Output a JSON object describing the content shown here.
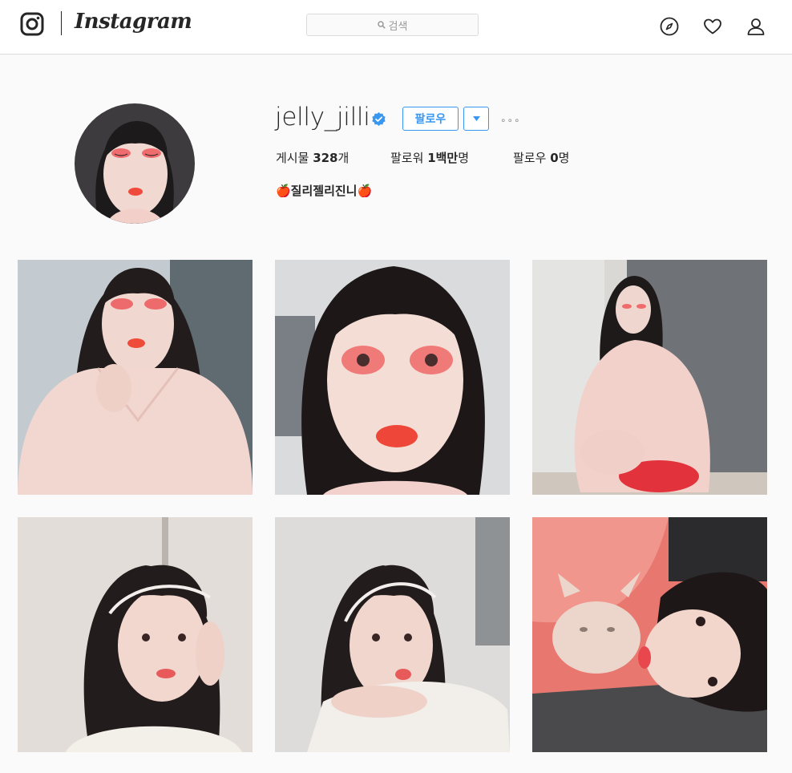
{
  "header": {
    "brand": "Instagram",
    "search_placeholder": "검색",
    "icons": [
      "instagram-glyph-icon",
      "search-icon",
      "compass-icon",
      "heart-icon",
      "user-icon"
    ]
  },
  "profile": {
    "username": "jelly_jilli",
    "follow_label": "팔로우",
    "more_label": "∘∘∘",
    "stats": {
      "posts_label": "게시물",
      "posts_value": "328",
      "posts_unit": "개",
      "followers_label": "팔로워",
      "followers_value": "1백만",
      "followers_unit": "명",
      "following_label": "팔로우",
      "following_value": "0",
      "following_unit": "명"
    },
    "bio": "🍎질리젤리진니🍎"
  },
  "colors": {
    "accent": "#3897f0",
    "verified": "#3897f0",
    "border": "#dbdbdb",
    "background": "#fafafa"
  },
  "posts": [
    {
      "subject": "selfie-red-eyeshadow"
    },
    {
      "subject": "closeup-red-eyes"
    },
    {
      "subject": "sitting-corner"
    },
    {
      "subject": "headband-selfie"
    },
    {
      "subject": "headband-pout"
    },
    {
      "subject": "with-sphynx-cat"
    }
  ]
}
